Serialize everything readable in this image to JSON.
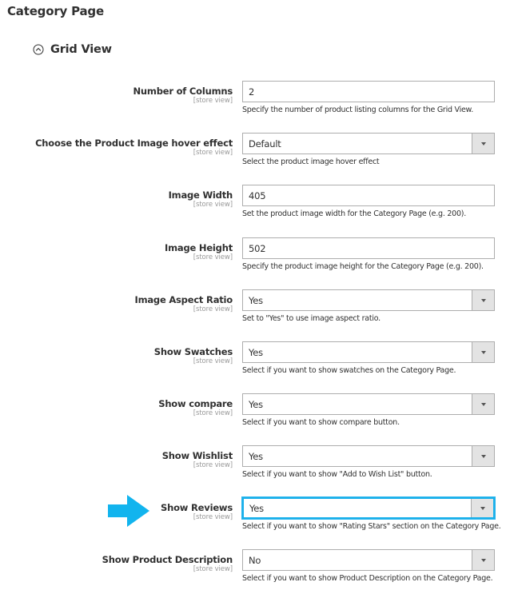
{
  "page": {
    "title": "Category Page"
  },
  "section": {
    "title": "Grid View",
    "icon": "collapse-circle-up-icon",
    "expanded": true
  },
  "fields": [
    {
      "id": "number-of-columns",
      "label": "Number of Columns",
      "scope": "[store view]",
      "type": "text",
      "value": "2",
      "note": "Specify the number of product listing columns for the Grid View."
    },
    {
      "id": "image-hover-effect",
      "label": "Choose the Product Image hover effect",
      "scope": "[store view]",
      "type": "select",
      "value": "Default",
      "note": "Select the product image hover effect"
    },
    {
      "id": "image-width",
      "label": "Image Width",
      "scope": "[store view]",
      "type": "text",
      "value": "405",
      "note": "Set the product image width for the Category Page (e.g. 200)."
    },
    {
      "id": "image-height",
      "label": "Image Height",
      "scope": "[store view]",
      "type": "text",
      "value": "502",
      "note": "Specify the product image height for the Category Page (e.g. 200)."
    },
    {
      "id": "image-aspect-ratio",
      "label": "Image Aspect Ratio",
      "scope": "[store view]",
      "type": "select",
      "value": "Yes",
      "note": "Set to \"Yes\" to use image aspect ratio."
    },
    {
      "id": "show-swatches",
      "label": "Show Swatches",
      "scope": "[store view]",
      "type": "select",
      "value": "Yes",
      "note": "Select if you want to show swatches on the Category Page."
    },
    {
      "id": "show-compare",
      "label": "Show compare",
      "scope": "[store view]",
      "type": "select",
      "value": "Yes",
      "note": "Select if you want to show compare button."
    },
    {
      "id": "show-wishlist",
      "label": "Show Wishlist",
      "scope": "[store view]",
      "type": "select",
      "value": "Yes",
      "note": "Select if you want to show \"Add to Wish List\" button."
    },
    {
      "id": "show-reviews",
      "label": "Show Reviews",
      "scope": "[store view]",
      "type": "select",
      "value": "Yes",
      "note": "Select if you want to show \"Rating Stars\" section on the Category Page.",
      "highlighted": true
    },
    {
      "id": "show-product-description",
      "label": "Show Product Description",
      "scope": "[store view]",
      "type": "select",
      "value": "No",
      "note": "Select if you want to show Product Description on the Category Page."
    }
  ],
  "annotation": {
    "icon": "pointer-arrow-icon",
    "color": "#12b4ee",
    "target": "show-reviews"
  },
  "colors": {
    "focus_border": "#1ab0ea",
    "text": "#303030",
    "scope_text": "#999999",
    "select_arrow_bg": "#e3e3e3"
  }
}
